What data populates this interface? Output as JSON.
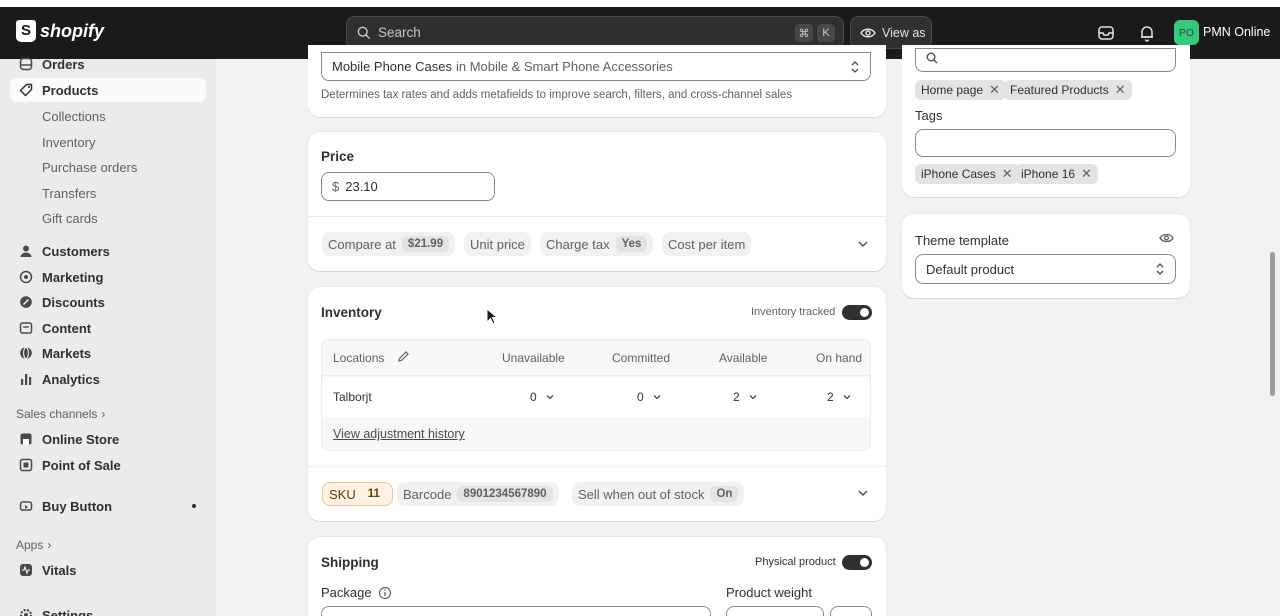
{
  "topbar": {
    "brand": "shopify",
    "search_placeholder": "Search",
    "kbd_cmd": "⌘",
    "kbd_k": "K",
    "view_as_label": "View as",
    "avatar_initials": "PO",
    "store_name": "PMN Online"
  },
  "sidebar": {
    "orders": "Orders",
    "products": "Products",
    "product_sub": [
      "Collections",
      "Inventory",
      "Purchase orders",
      "Transfers",
      "Gift cards"
    ],
    "customers": "Customers",
    "marketing": "Marketing",
    "discounts": "Discounts",
    "content": "Content",
    "markets": "Markets",
    "analytics": "Analytics",
    "sales_channels_label": "Sales channels",
    "online_store": "Online Store",
    "point_of_sale": "Point of Sale",
    "buy_button": "Buy Button",
    "apps_label": "Apps",
    "vitals": "Vitals",
    "settings_partial": "Settings"
  },
  "category": {
    "value_main": "Mobile Phone Cases",
    "value_path": "in Mobile & Smart Phone Accessories",
    "help": "Determines tax rates and adds metafields to improve search, filters, and cross-channel sales"
  },
  "price": {
    "title": "Price",
    "currency": "$",
    "value": "23.10",
    "compare_label": "Compare at",
    "compare_value": "$21.99",
    "unit_price_label": "Unit price",
    "charge_tax_label": "Charge tax",
    "charge_tax_value": "Yes",
    "cost_label": "Cost per item"
  },
  "inventory": {
    "title": "Inventory",
    "tracked_label": "Inventory tracked",
    "columns": [
      "Locations",
      "Unavailable",
      "Committed",
      "Available",
      "On hand"
    ],
    "row": {
      "location": "Talborjt",
      "unavailable": "0",
      "committed": "0",
      "available": "2",
      "on_hand": "2"
    },
    "history_link": "View adjustment history",
    "sku_label": "SKU",
    "sku_value": "11",
    "barcode_label": "Barcode",
    "barcode_value": "8901234567890",
    "sell_oos_label": "Sell when out of stock",
    "sell_oos_value": "On"
  },
  "shipping": {
    "title": "Shipping",
    "physical_label": "Physical product",
    "package_label": "Package",
    "weight_label": "Product weight"
  },
  "organization": {
    "collections": [
      "Home page",
      "Featured Products"
    ],
    "tags_label": "Tags",
    "tags": [
      "iPhone Cases",
      "iPhone 16"
    ]
  },
  "theme": {
    "label": "Theme template",
    "value": "Default product"
  },
  "colors": {
    "topbar": "#1a1a1a",
    "background": "#f1f1f1",
    "avatar": "#36c97b",
    "sku_chip": "#fff1e3"
  }
}
